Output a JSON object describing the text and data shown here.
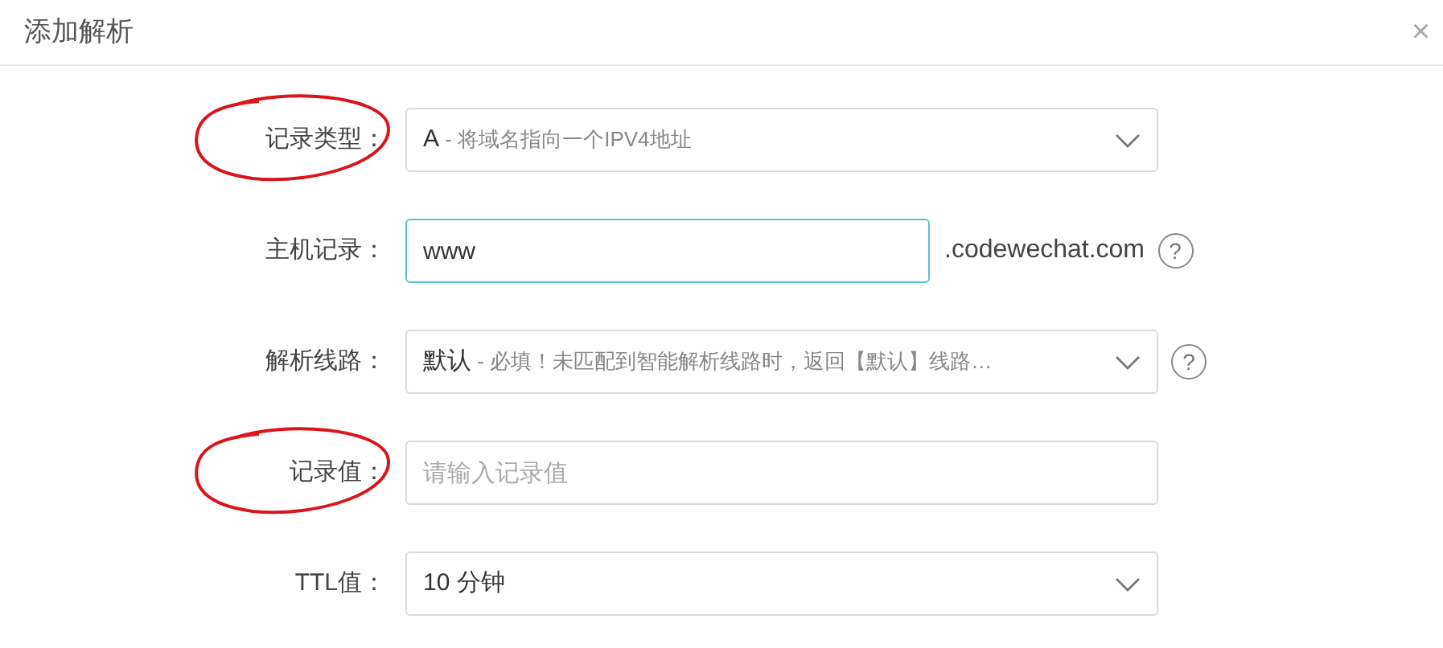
{
  "dialog": {
    "title": "添加解析",
    "close": "×"
  },
  "fields": [
    {
      "kind": "select",
      "label": "记录类型：",
      "annotated": true,
      "value": "A",
      "hint": "- 将域名指向一个IPV4地址"
    },
    {
      "kind": "input",
      "label": "主机记录：",
      "annotated": false,
      "value": "www",
      "focused": true,
      "suffix": ".codewechat.com",
      "help": "?"
    },
    {
      "kind": "select",
      "label": "解析线路：",
      "annotated": false,
      "value": "默认",
      "hint": "- 必填！未匹配到智能解析线路时，返回【默认】线路…",
      "help": "?"
    },
    {
      "kind": "input",
      "label": "记录值：",
      "annotated": true,
      "placeholder": "请输入记录值",
      "focused": false
    },
    {
      "kind": "select",
      "label": "TTL值：",
      "annotated": false,
      "value": "10 分钟"
    }
  ]
}
